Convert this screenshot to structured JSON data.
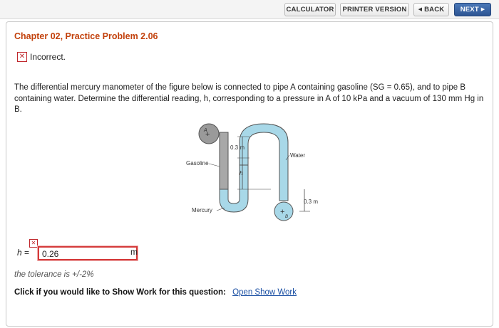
{
  "toolbar": {
    "calculator_label": "CALCULATOR",
    "printer_label": "PRINTER VERSION",
    "back_label": "BACK",
    "next_label": "NEXT"
  },
  "problem": {
    "title": "Chapter 02, Practice Problem 2.06",
    "status": "Incorrect.",
    "question": "The differential mercury manometer of the figure below is connected to pipe A containing gasoline (SG = 0.65), and to pipe B containing water. Determine the differential reading, h, corresponding to a pressure in A of 10 kPa and a vacuum of 130 mm Hg in B."
  },
  "figure": {
    "pipe_a": "A",
    "pipe_b": "B",
    "gasoline": "Gasoline",
    "water": "Water",
    "mercury": "Mercury",
    "dim_top": "0.3 m",
    "dim_h": "h",
    "dim_right": "0.3 m"
  },
  "answer": {
    "variable": "h",
    "equals": "=",
    "value": "0.26",
    "unit": "m"
  },
  "tolerance": "the tolerance is +/-2%",
  "show_work": {
    "prompt": "Click if you would like to Show Work for this question:",
    "link": "Open Show Work"
  },
  "colors": {
    "title": "#c2410c",
    "error": "#d43a3a",
    "link": "#1a4fa3",
    "water": "#a8d8e8",
    "gasoline": "#a0a0a0"
  }
}
